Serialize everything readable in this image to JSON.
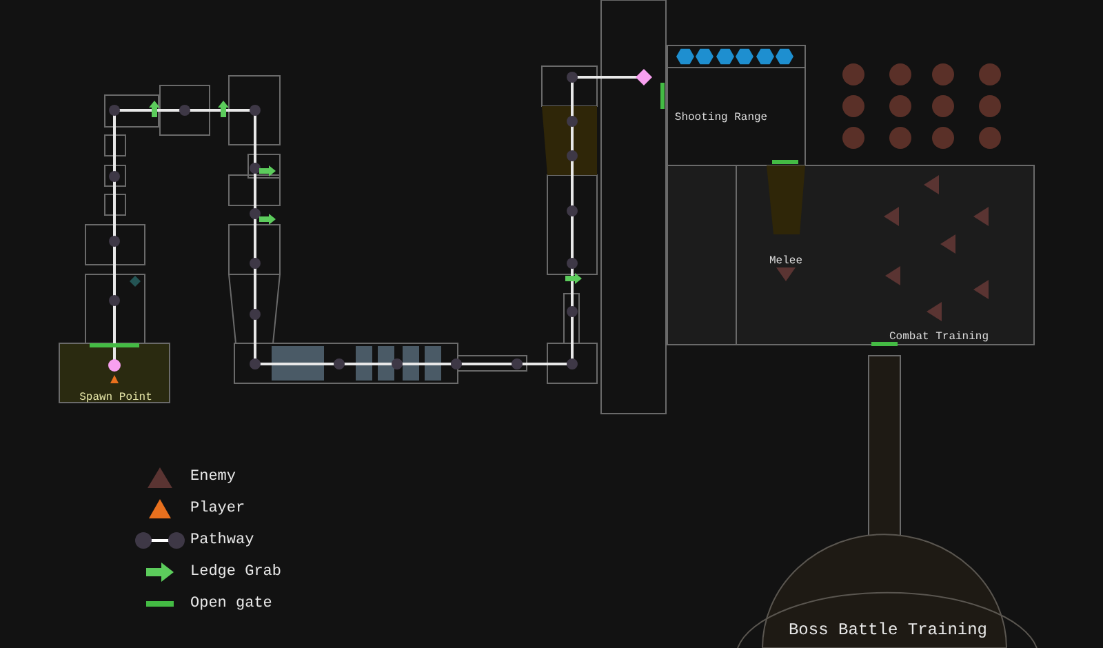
{
  "map_labels": [
    {
      "kind": "spawn",
      "text": "Spawn Point"
    },
    {
      "kind": "shooting",
      "text": "Shooting Range"
    },
    {
      "kind": "melee",
      "text": "Melee"
    },
    {
      "kind": "combat",
      "text": "Combat Training"
    },
    {
      "kind": "boss",
      "text": "Boss Battle Training"
    }
  ],
  "legend": [
    {
      "kind": "enemy",
      "label": "Enemy"
    },
    {
      "kind": "player",
      "label": "Player"
    },
    {
      "kind": "pathway",
      "label": "Pathway"
    },
    {
      "kind": "ledge_grab",
      "label": "Ledge Grab"
    },
    {
      "kind": "open_gate",
      "label": "Open gate"
    }
  ]
}
